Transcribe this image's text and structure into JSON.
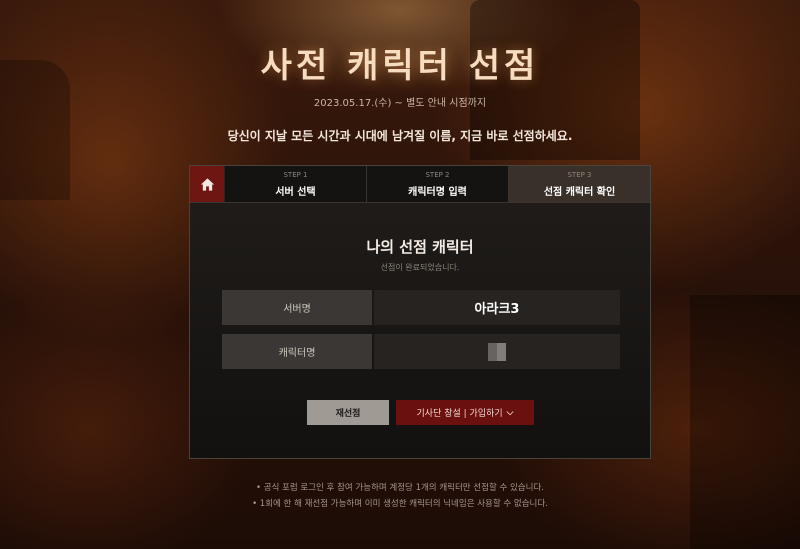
{
  "header": {
    "title": "사전 캐릭터 선점",
    "date_range": "2023.05.17.(수) ~ 별도 안내 시점까지",
    "subtitle": "당신이 지날 모든 시간과 시대에 남겨질 이름, 지금 바로 선점하세요."
  },
  "steps": [
    {
      "step": "STEP 1",
      "label": "서버 선택"
    },
    {
      "step": "STEP 2",
      "label": "캐릭터명 입력"
    },
    {
      "step": "STEP 3",
      "label": "선점 캐릭터 확인"
    }
  ],
  "active_step_index": 2,
  "result": {
    "title": "나의 선점 캐릭터",
    "subtitle": "선점이 완료되었습니다.",
    "rows": [
      {
        "key": "서버명",
        "value": "아라크3"
      },
      {
        "key": "캐릭터명",
        "value": ""
      }
    ]
  },
  "buttons": {
    "reselect": "재선점",
    "guild": "기사단 창설 | 가입하기"
  },
  "notes": [
    "• 공식 포럼 로그인 후 참여 가능하며 계정당 1개의 캐릭터만 선점할 수 있습니다.",
    "• 1회에 한 해 재선점 가능하며 이미 생성한 캐릭터의 닉네임은 사용할 수 없습니다."
  ],
  "colors": {
    "accent_red": "#6a100e",
    "title_gold": "#f7dcc0",
    "panel_bg": "#1a1715"
  },
  "icons": {
    "home": "home-icon",
    "dropdown": "chevron-down-icon"
  }
}
